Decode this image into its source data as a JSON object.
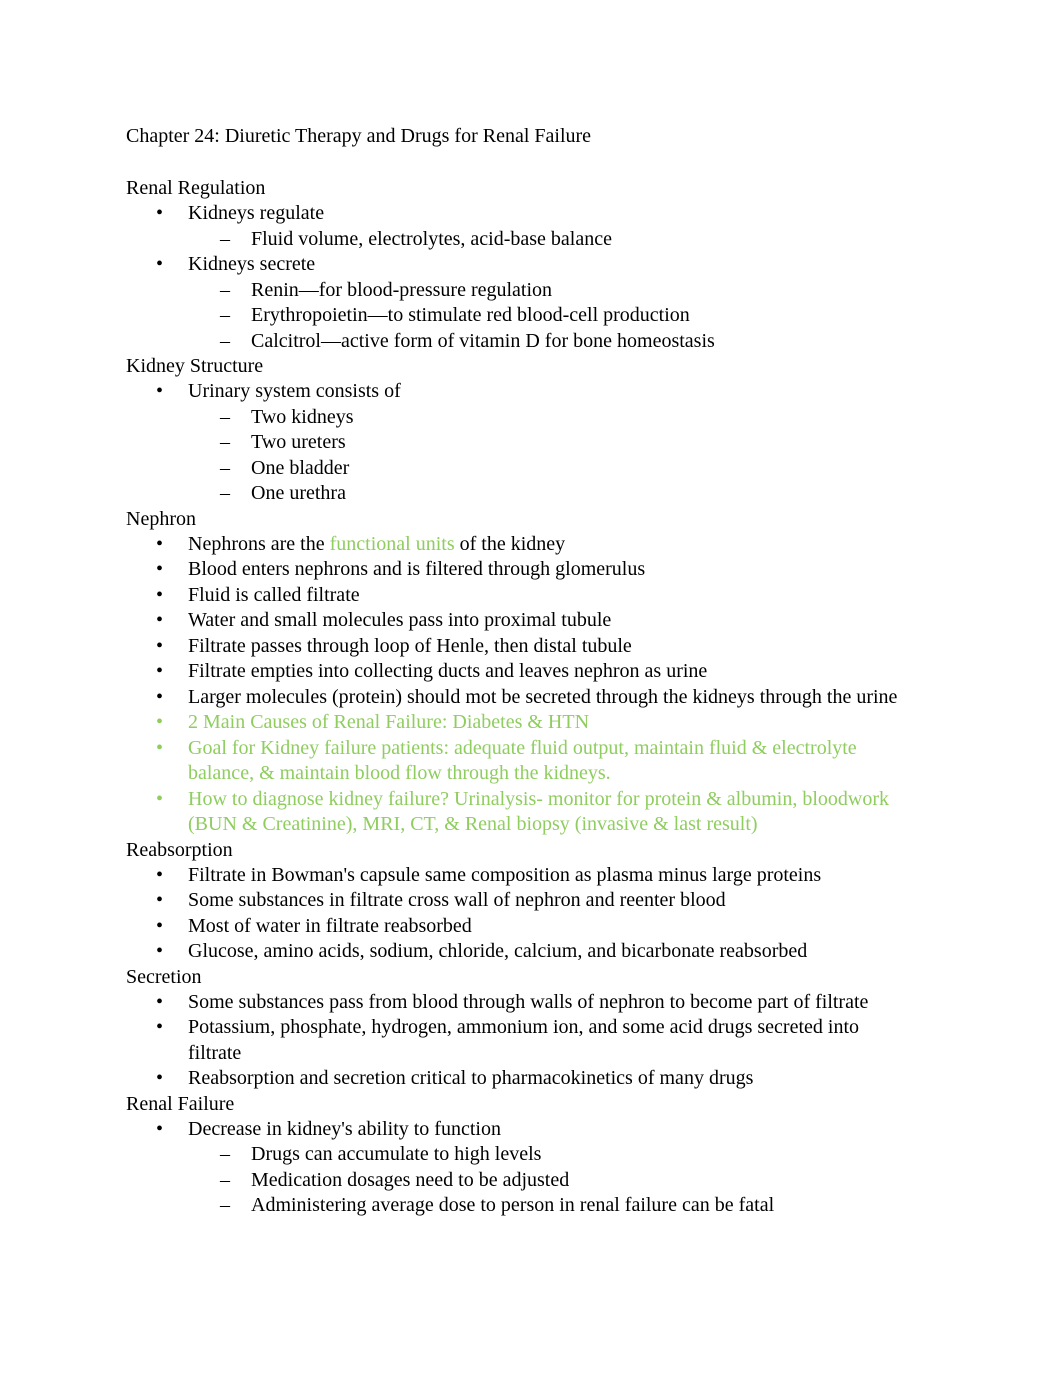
{
  "document": {
    "title": "Chapter 24: Diuretic Therapy and Drugs for Renal Failure",
    "accent_color": "#8fcd5f",
    "bullet_glyph": "•",
    "dash_glyph": "–",
    "sections": [
      {
        "heading": "Renal Regulation",
        "items": [
          {
            "text": "Kidneys regulate",
            "children": [
              "Fluid volume, electrolytes, acid-base balance"
            ]
          },
          {
            "text": "Kidneys secrete",
            "children": [
              "Renin—for blood-pressure regulation",
              "Erythropoietin—to stimulate red blood-cell production",
              "Calcitrol—active form of vitamin D for bone homeostasis"
            ]
          }
        ]
      },
      {
        "heading": "Kidney Structure",
        "items": [
          {
            "text": "Urinary system consists of",
            "children": [
              "Two kidneys",
              "Two ureters",
              "One bladder",
              "One urethra"
            ]
          }
        ]
      },
      {
        "heading": "Nephron",
        "items": [
          {
            "text_before": "Nephrons are the ",
            "text_highlight": "functional units",
            "text_after": " of the kidney"
          },
          {
            "text": "Blood enters nephrons and is filtered through glomerulus"
          },
          {
            "text": "Fluid is called filtrate"
          },
          {
            "text": "Water and small molecules pass into proximal tubule"
          },
          {
            "text": "Filtrate passes through loop of Henle, then distal tubule"
          },
          {
            "text": "Filtrate empties into collecting ducts and leaves nephron as urine"
          },
          {
            "text": "Larger molecules (protein) should mot be secreted through the kidneys through the urine"
          },
          {
            "text": "2 Main Causes of Renal Failure: Diabetes & HTN",
            "highlight": true
          },
          {
            "text": "Goal for Kidney failure patients: adequate fluid output, maintain fluid & electrolyte balance, & maintain blood flow through the kidneys.",
            "highlight": true
          },
          {
            "text": "How to diagnose kidney failure? Urinalysis- monitor for protein & albumin, bloodwork (BUN & Creatinine), MRI, CT, & Renal biopsy (invasive & last result)",
            "highlight": true
          }
        ]
      },
      {
        "heading": "Reabsorption",
        "items": [
          {
            "text": "Filtrate in Bowman's capsule same composition as plasma minus large proteins"
          },
          {
            "text": "Some substances in filtrate cross wall of nephron and reenter blood"
          },
          {
            "text": "Most of water in filtrate reabsorbed"
          },
          {
            "text": "Glucose, amino acids, sodium, chloride, calcium, and bicarbonate reabsorbed"
          }
        ]
      },
      {
        "heading": "Secretion",
        "items": [
          {
            "text": "Some substances pass from blood through walls of nephron to become part of filtrate"
          },
          {
            "text": "Potassium, phosphate, hydrogen, ammonium ion, and some acid drugs secreted into filtrate"
          },
          {
            "text": "Reabsorption and secretion critical to pharmacokinetics of many drugs"
          }
        ]
      },
      {
        "heading": "Renal Failure",
        "items": [
          {
            "text": "Decrease in kidney's ability to function",
            "children": [
              "Drugs can accumulate to high levels",
              "Medication dosages need to be  adjusted",
              "Administering average dose to person in renal failure can be fatal"
            ]
          }
        ]
      }
    ]
  }
}
